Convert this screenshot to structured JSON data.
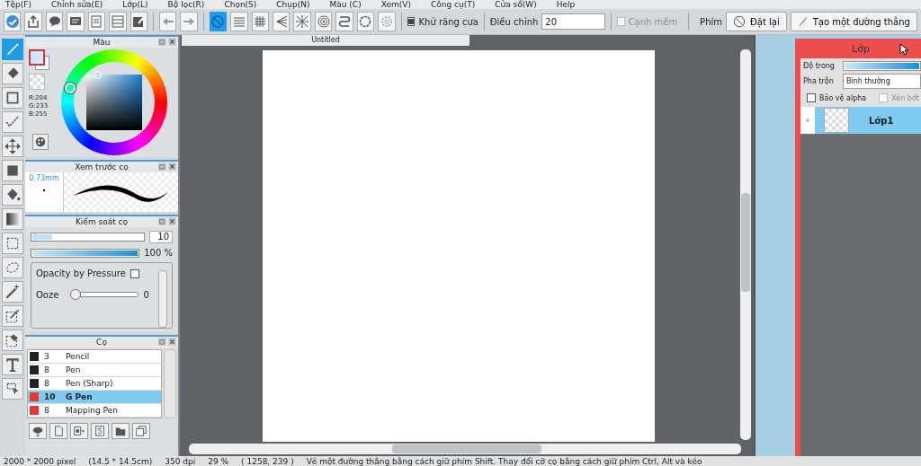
{
  "menu": [
    "Tệp(F)",
    "Chỉnh sửa(E)",
    "Lớp(L)",
    "Bộ lọc(R)",
    "Chọn(S)",
    "Chụp(N)",
    "Màu (C)",
    "Xem(V)",
    "Công cụ(T)",
    "Cửa sổ(W)",
    "Help"
  ],
  "ruler_tools": [
    {
      "selected": true
    },
    {
      "selected": false
    },
    {
      "selected": false
    },
    {
      "selected": false
    },
    {
      "selected": false
    },
    {
      "selected": false
    },
    {
      "selected": false
    },
    {
      "selected": false
    },
    {
      "selected": false
    }
  ],
  "antialias": {
    "label": "Khử răng cưa",
    "checked": true
  },
  "adjust": {
    "label": "Điều chỉnh",
    "value": "20"
  },
  "smooth_edge": {
    "label": "Cạnh mềm",
    "checked": false,
    "disabled": true
  },
  "keys_label": "Phím",
  "buttons": [
    "Đặt lại",
    "Tạo một đường thẳng"
  ],
  "tools": [
    {
      "selected": true
    },
    {
      "selected": false
    },
    {
      "selected": false
    },
    {
      "selected": false
    },
    {
      "selected": false
    },
    {
      "selected": false
    },
    {
      "selected": false
    },
    {
      "selected": false
    },
    {
      "selected": false
    },
    {
      "selected": false
    },
    {
      "selected": false
    },
    {
      "selected": false
    },
    {
      "selected": false
    },
    {
      "selected": false
    },
    {
      "selected": false
    }
  ],
  "color_panel": {
    "title": "Màu",
    "rgb": [
      "R:204",
      "G:233",
      "B:255"
    ]
  },
  "preview_panel": {
    "title": "Xem trước cọ",
    "size": "0.73mm"
  },
  "brush_control": {
    "title": "Kiểm soát cọ",
    "size": {
      "level": 0.18,
      "value": "10"
    },
    "opacity": {
      "level": 1,
      "reading": "100 %"
    },
    "pressure": {
      "label": "Opacity by Pressure",
      "checked": false
    },
    "ooze": {
      "label": "Ooze",
      "level": 0,
      "reading": "0"
    }
  },
  "brushes": {
    "title": "Cọ",
    "items": [
      {
        "size": "3",
        "name": "Pencil",
        "color": "#222222",
        "selected": false
      },
      {
        "size": "8",
        "name": "Pen",
        "color": "#222222",
        "selected": false
      },
      {
        "size": "8",
        "name": "Pen (Sharp)",
        "color": "#222222",
        "selected": false
      },
      {
        "size": "10",
        "name": "G Pen",
        "color": "#ee3333",
        "selected": true
      },
      {
        "size": "8",
        "name": "Mapping Pen",
        "color": "#ee3333",
        "selected": false
      }
    ]
  },
  "document": {
    "tab": "Untitled"
  },
  "layer_panel": {
    "title": "Lớp",
    "opacity": {
      "label": "Độ trong",
      "level": 1
    },
    "blend_label": "Pha trộn",
    "blend_value": "Bình thường",
    "protect_alpha": {
      "label": "Bảo vệ alpha",
      "checked": false
    },
    "clip": {
      "label": "Xén bớt",
      "checked": false,
      "disabled": true
    },
    "layers": [
      {
        "name": "Lớp1",
        "selected": true
      }
    ]
  },
  "status": [
    "2000 * 2000 pixel",
    "(14.5 * 14.5cm)",
    "350 dpi",
    "29 %",
    "( 1258, 239 )",
    "Vẽ một đường thẳng bằng cách giữ phím Shift. Thay đổi cỡ cọ bằng cách giữ phím Ctrl, Alt và kéo"
  ]
}
